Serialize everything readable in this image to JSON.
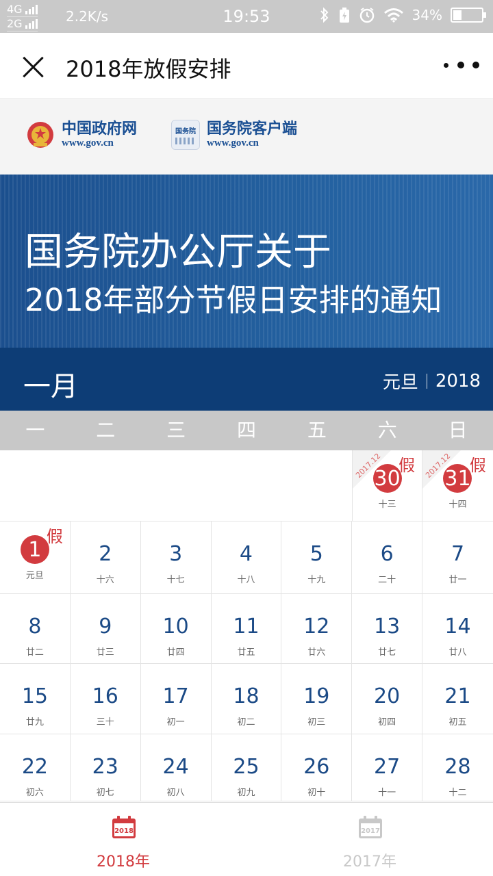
{
  "status_bar": {
    "net_top": "4G",
    "net_bottom": "2G",
    "speed": "2.2K/s",
    "time": "19:53",
    "battery": "34%"
  },
  "title_bar": {
    "title": "2018年放假安排"
  },
  "logos": {
    "gov": {
      "name": "中国政府网",
      "url": "www.gov.cn"
    },
    "app": {
      "name": "国务院客户端",
      "url": "www.gov.cn",
      "badge": "国务院"
    }
  },
  "banner": {
    "line1": "国务院办公厅关于",
    "line2": "2018年部分节假日安排的通知"
  },
  "month_bar": {
    "month": "一月",
    "holiday": "元旦",
    "year": "2018"
  },
  "weekdays": [
    "一",
    "二",
    "三",
    "四",
    "五",
    "六",
    "日"
  ],
  "calendar": {
    "holiday_mark": "假",
    "prev_month_label": "2017.12",
    "rows": [
      [
        null,
        null,
        null,
        null,
        null,
        {
          "day": "30",
          "lunar": "十三",
          "holiday": true,
          "prev": true
        },
        {
          "day": "31",
          "lunar": "十四",
          "holiday": true,
          "prev": true
        }
      ],
      [
        {
          "day": "1",
          "lunar": "元旦",
          "holiday": true
        },
        {
          "day": "2",
          "lunar": "十六"
        },
        {
          "day": "3",
          "lunar": "十七"
        },
        {
          "day": "4",
          "lunar": "十八"
        },
        {
          "day": "5",
          "lunar": "十九"
        },
        {
          "day": "6",
          "lunar": "二十"
        },
        {
          "day": "7",
          "lunar": "廿一"
        }
      ],
      [
        {
          "day": "8",
          "lunar": "廿二"
        },
        {
          "day": "9",
          "lunar": "廿三"
        },
        {
          "day": "10",
          "lunar": "廿四"
        },
        {
          "day": "11",
          "lunar": "廿五"
        },
        {
          "day": "12",
          "lunar": "廿六"
        },
        {
          "day": "13",
          "lunar": "廿七"
        },
        {
          "day": "14",
          "lunar": "廿八"
        }
      ],
      [
        {
          "day": "15",
          "lunar": "廿九"
        },
        {
          "day": "16",
          "lunar": "三十"
        },
        {
          "day": "17",
          "lunar": "初一"
        },
        {
          "day": "18",
          "lunar": "初二"
        },
        {
          "day": "19",
          "lunar": "初三"
        },
        {
          "day": "20",
          "lunar": "初四"
        },
        {
          "day": "21",
          "lunar": "初五"
        }
      ],
      [
        {
          "day": "22",
          "lunar": "初六"
        },
        {
          "day": "23",
          "lunar": "初七"
        },
        {
          "day": "24",
          "lunar": "初八"
        },
        {
          "day": "25",
          "lunar": "初九"
        },
        {
          "day": "26",
          "lunar": "初十"
        },
        {
          "day": "27",
          "lunar": "十一"
        },
        {
          "day": "28",
          "lunar": "十二"
        }
      ]
    ]
  },
  "tabs": [
    {
      "label": "2018年",
      "icon_text": "2018",
      "active": true
    },
    {
      "label": "2017年",
      "icon_text": "2017",
      "active": false
    }
  ],
  "colors": {
    "holiday_red": "#d23b3f",
    "navy": "#0d3d76",
    "date_blue": "#1b4a86",
    "inactive_gray": "#c8c8c8"
  }
}
